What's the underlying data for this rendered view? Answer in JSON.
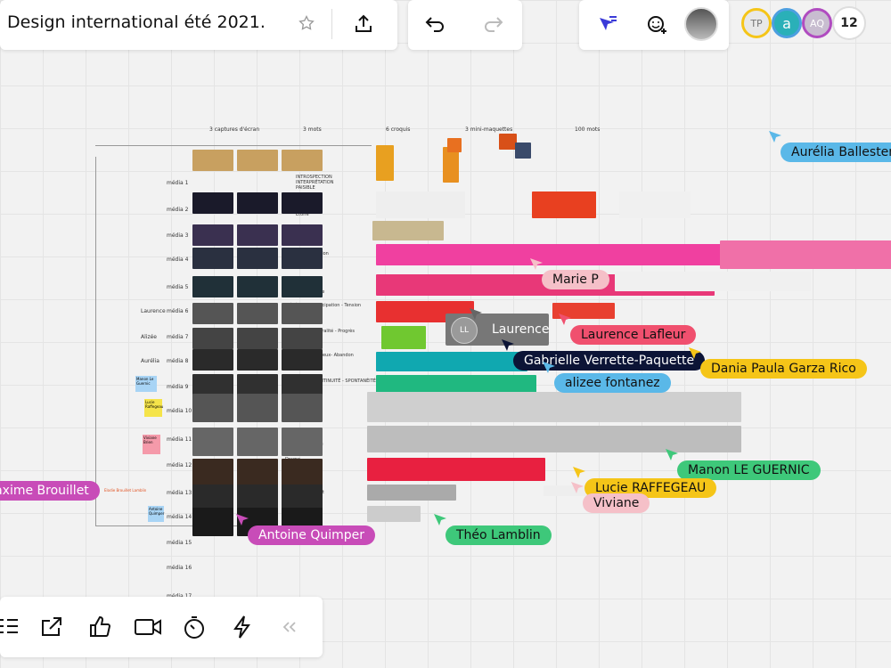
{
  "board": {
    "title": "Design international été 2021."
  },
  "toolbar": {
    "count": "12"
  },
  "collaborators": [
    {
      "initials": "TP",
      "bg": "#e8e8e8",
      "border": "#f5c518",
      "color": "#777"
    },
    {
      "initials": "a",
      "bg": "#2ab0b8",
      "border": "#4c9fe0",
      "color": "#fff"
    },
    {
      "initials": "AQ",
      "bg": "#c8bdd0",
      "border": "#b04cc0",
      "color": "#fff"
    }
  ],
  "columns": [
    "3 captures d'écran",
    "3 mots",
    "6 croquis",
    "3 mini-maquettes",
    "100 mots"
  ],
  "rows": [
    {
      "label": "média 1",
      "name": "",
      "words": "INTROSPECTION\nINTERPRÉTATION\nPAISIBLE"
    },
    {
      "label": "média 2",
      "name": "",
      "words": "Contraste\nPouvoir\nÉtoffe"
    },
    {
      "label": "média 3",
      "name": "",
      "words": "Inversion\nMouvement\nContinuité"
    },
    {
      "label": "média 4",
      "name": "",
      "words": "Contemplation\nPuissance\nScupant"
    },
    {
      "label": "média 5",
      "name": "",
      "words": "Sauvagerie\nPerspective\nAmbivalence"
    },
    {
      "label": "média 6",
      "name": "Laurence",
      "words": "Frénétique - Anticipation - Tension"
    },
    {
      "label": "média 7",
      "name": "Alizée",
      "words": "Échange - Cérébralité - Progrès"
    },
    {
      "label": "média 8",
      "name": "Aurélia",
      "words": "Débordant- Précieux- Abandon"
    },
    {
      "label": "média 9",
      "name": "",
      "words": "COHÉSION - CONTINUITÉ - SPONTANÉITÉ"
    },
    {
      "label": "média 10",
      "name": "",
      "words": "Tension\nDéséquilibre\nItération"
    },
    {
      "label": "média 11",
      "name": "",
      "words": "Agrandissement\nComposition\nInterdépendance"
    },
    {
      "label": "média 12",
      "name": "",
      "words": "Drame\nAmour\nLunaire"
    },
    {
      "label": "média 13",
      "name": "",
      "words": "Appartenance\nAffranchissement\nÉtonnement"
    },
    {
      "label": "média 14",
      "name": "",
      "words": ""
    },
    {
      "label": "média 15",
      "name": "",
      "words": ""
    },
    {
      "label": "média 16",
      "name": "",
      "words": ""
    },
    {
      "label": "média 17",
      "name": "",
      "words": ""
    }
  ],
  "stickies": [
    {
      "text": "Manon\nLe Guernic",
      "color": "#a8d4f5"
    },
    {
      "text": "Lucie\nRaffegeau",
      "color": "#f5e44a"
    },
    {
      "text": "Viviane\nBrien",
      "color": "#f59aaa"
    },
    {
      "text": "Antoine\nQuimper",
      "color": "#a8d4f5"
    }
  ],
  "cursors": [
    {
      "name": "Aurélia Ballester",
      "color": "#5ab8e8"
    },
    {
      "name": "Marie P",
      "color": "#f5c0c8"
    },
    {
      "name": "Laurence",
      "color": "#666666"
    },
    {
      "name": "Laurence Lafleur",
      "color": "#f0506e"
    },
    {
      "name": "Gabrielle Verrette-Paquette",
      "color": "#0c1436"
    },
    {
      "name": "Dania Paula Garza Rico",
      "color": "#f5c518"
    },
    {
      "name": "alizee fontanez",
      "color": "#5ab8e8"
    },
    {
      "name": "Manon LE GUERNIC",
      "color": "#3ec87a"
    },
    {
      "name": "Lucie RAFFEGEAU",
      "color": "#f5c518"
    },
    {
      "name": "Viviane",
      "color": "#f5c0c8"
    },
    {
      "name": "Maxime Brouillet",
      "color": "#c84cb8"
    },
    {
      "name": "Antoine Quimper",
      "color": "#c84cb8"
    },
    {
      "name": "Théo Lamblin",
      "color": "#3ec87a"
    }
  ],
  "laurence_badge": "LL",
  "small_note": "Elodie Brouillet Lamblin"
}
